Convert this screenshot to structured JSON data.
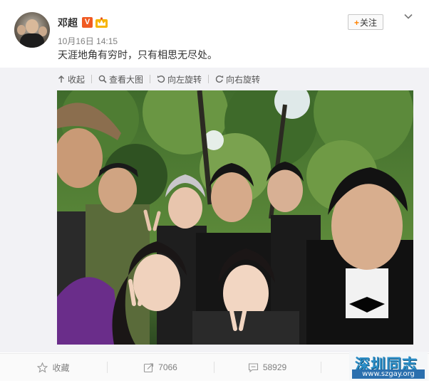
{
  "post": {
    "username": "邓超",
    "vip_badge": "V",
    "timestamp": "10月16日 14:15",
    "text": "天涯地角有穷时，只有相思无尽处。",
    "follow_label": "关注",
    "follow_plus": "+"
  },
  "media_toolbar": {
    "items": [
      {
        "label": "收起",
        "icon": "arrow-up-icon"
      },
      {
        "label": "查看大图",
        "icon": "magnifier-icon"
      },
      {
        "label": "向左旋转",
        "icon": "rotate-left-icon"
      },
      {
        "label": "向右旋转",
        "icon": "rotate-right-icon"
      }
    ]
  },
  "photo": {
    "description_icon": "group-selfie-photo"
  },
  "actions": {
    "favorite": {
      "label": "收藏",
      "icon": "star-icon"
    },
    "repost": {
      "label": "7066",
      "icon": "repost-icon"
    },
    "comment": {
      "label": "58929",
      "icon": "comment-icon"
    },
    "like": {
      "label": "",
      "icon": "thumb-up-icon"
    }
  },
  "watermark": {
    "title": "深圳同志",
    "url": "www.szgay.org"
  },
  "colors": {
    "accent_orange": "#ff8200",
    "vip_badge": "#f05a22",
    "watermark_blue": "#2b8fc9",
    "link_gray": "#808080"
  }
}
